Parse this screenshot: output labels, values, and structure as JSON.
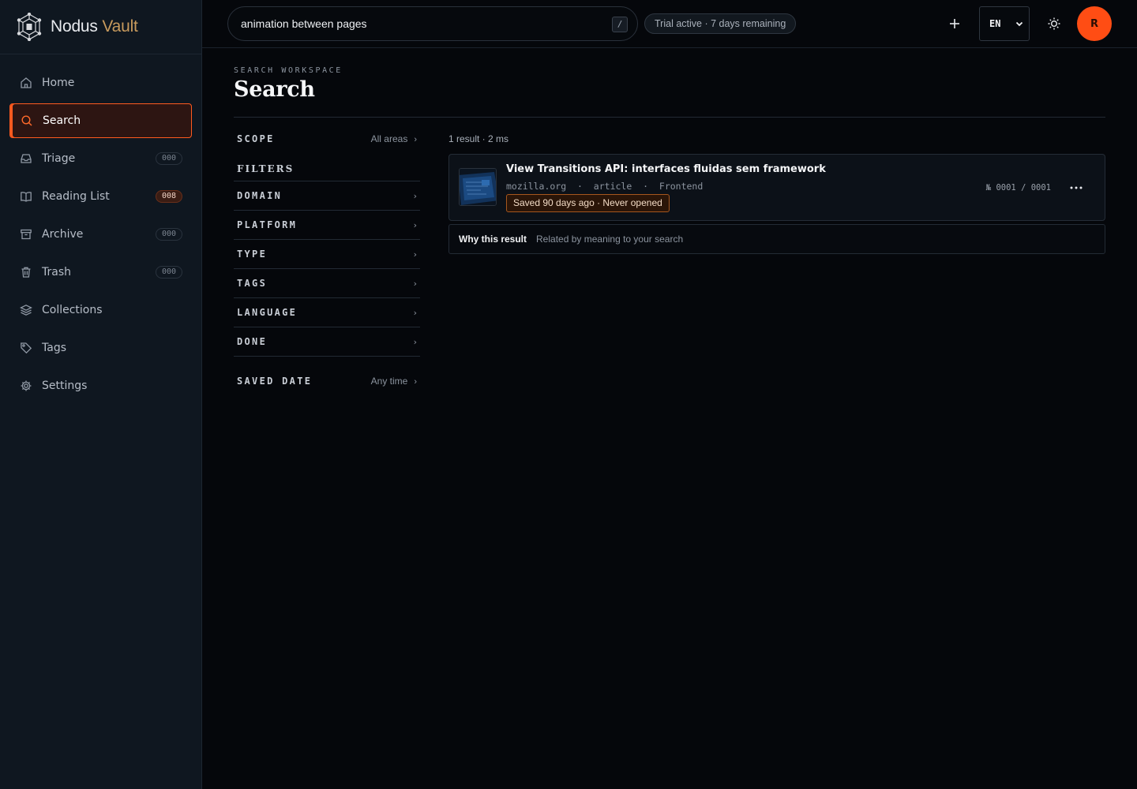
{
  "brand": {
    "word1": "Nodus",
    "word2": "Vault"
  },
  "sidebar": {
    "items": [
      {
        "label": "Home",
        "icon": "home-icon"
      },
      {
        "label": "Search",
        "icon": "search-icon",
        "active": true
      },
      {
        "label": "Triage",
        "icon": "inbox-icon",
        "badge": "000"
      },
      {
        "label": "Reading List",
        "icon": "book-icon",
        "badge": "008"
      },
      {
        "label": "Archive",
        "icon": "archive-icon",
        "badge": "000"
      },
      {
        "label": "Trash",
        "icon": "trash-icon",
        "badge": "000"
      },
      {
        "label": "Collections",
        "icon": "layers-icon"
      },
      {
        "label": "Tags",
        "icon": "tag-icon"
      },
      {
        "label": "Settings",
        "icon": "gear-icon"
      }
    ]
  },
  "topbar": {
    "search_value": "animation between pages",
    "shortcut": "/",
    "trial": "Trial active · 7 days remaining",
    "language": "EN",
    "avatar_initial": "R"
  },
  "page": {
    "eyebrow": "SEARCH WORKSPACE",
    "title": "Search"
  },
  "filters": {
    "scope_label": "SCOPE",
    "scope_value": "All areas",
    "heading": "FILTERS",
    "items": [
      "DOMAIN",
      "PLATFORM",
      "TYPE",
      "TAGS",
      "LANGUAGE",
      "DONE"
    ],
    "saved_date_label": "SAVED DATE",
    "saved_date_value": "Any time"
  },
  "results": {
    "meta": "1 result · 2 ms",
    "items": [
      {
        "title": "View Transitions API: interfaces fluidas sem framework",
        "domain": "mozilla.org",
        "type": "article",
        "category": "Frontend",
        "status": "Saved 90 days ago · Never opened",
        "index": "№ 0001 / 0001"
      }
    ],
    "why_label": "Why this result",
    "why_text": "Related by meaning to your search"
  },
  "colors": {
    "accent": "#ff5a1f",
    "brand_gold": "#c79a5d",
    "background": "#05070b",
    "sidebar": "#0f1720"
  }
}
